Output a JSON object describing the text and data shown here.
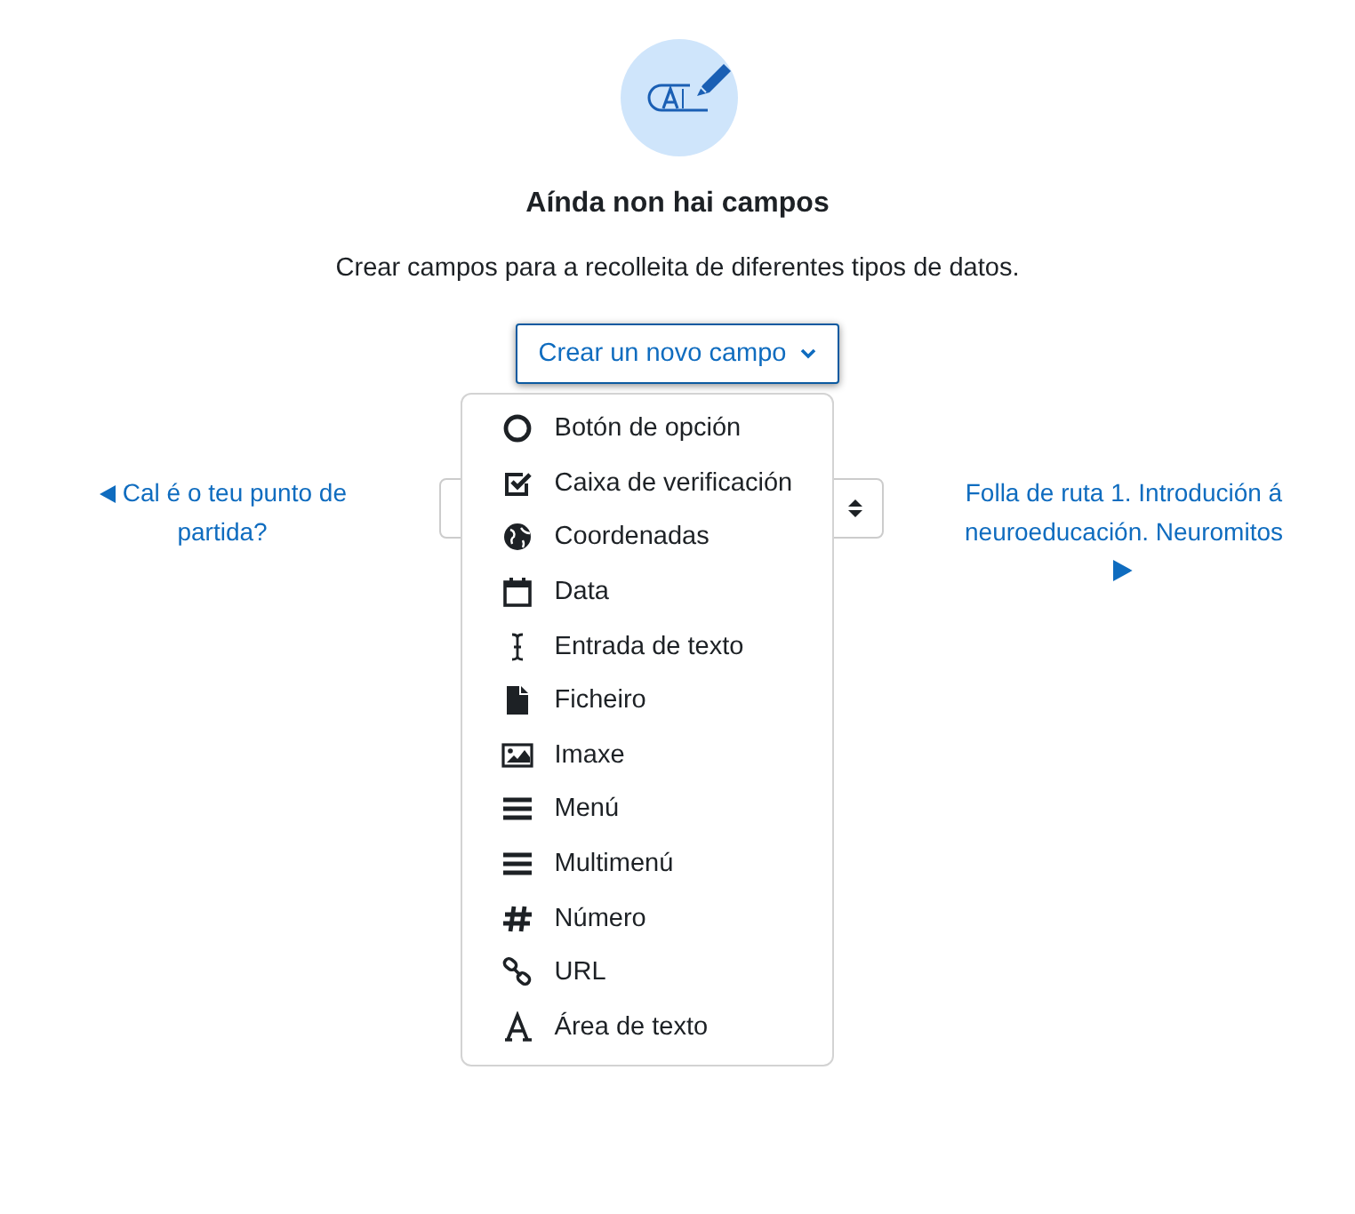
{
  "empty_state": {
    "title": "Aínda non hai campos",
    "description": "Crear campos para a recolleita de diferentes tipos de datos."
  },
  "create_button": {
    "label": "Crear un novo campo",
    "expanded": true
  },
  "menu_items": [
    {
      "kind": "radio",
      "label": "Botón de opción"
    },
    {
      "kind": "checkbox",
      "label": "Caixa de verificación"
    },
    {
      "kind": "globe",
      "label": "Coordenadas"
    },
    {
      "kind": "calendar",
      "label": "Data"
    },
    {
      "kind": "cursor",
      "label": "Entrada de texto"
    },
    {
      "kind": "file",
      "label": "Ficheiro"
    },
    {
      "kind": "image",
      "label": "Imaxe"
    },
    {
      "kind": "menu",
      "label": "Menú"
    },
    {
      "kind": "menu",
      "label": "Multimenú"
    },
    {
      "kind": "hash",
      "label": "Número"
    },
    {
      "kind": "link",
      "label": "URL"
    },
    {
      "kind": "font",
      "label": "Área de texto"
    }
  ],
  "navigation": {
    "previous": "Cal é o teu punto de partida?",
    "next": "Folla de ruta 1. Introdución á neuroeducación. Neuromitos"
  }
}
